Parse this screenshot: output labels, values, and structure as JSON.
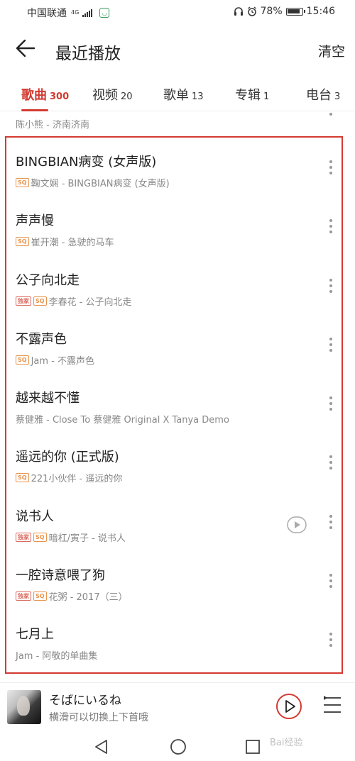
{
  "status_bar": {
    "carrier": "中国联通",
    "network_type": "4G",
    "battery_percent": "78%",
    "battery_level": 0.78,
    "time": "15:46"
  },
  "header": {
    "title": "最近播放",
    "clear_label": "清空"
  },
  "tabs": [
    {
      "label": "歌曲",
      "count": "300"
    },
    {
      "label": "视频",
      "count": "20"
    },
    {
      "label": "歌单",
      "count": "13"
    },
    {
      "label": "专辑",
      "count": "1"
    },
    {
      "label": "电台",
      "count": "3"
    }
  ],
  "partial_row": {
    "subtitle": "陈小熊 - 济南济南"
  },
  "songs": [
    {
      "title": "BINGBIAN病变 (女声版)",
      "subtitle": "鞠文娴 - BINGBIAN病变 (女声版)",
      "exclusive": false,
      "sq": true,
      "has_mv": false
    },
    {
      "title": "声声慢",
      "subtitle": "崔开潮 - 急驶的马车",
      "exclusive": false,
      "sq": true,
      "has_mv": false
    },
    {
      "title": "公子向北走",
      "subtitle": "李春花 - 公子向北走",
      "exclusive": true,
      "sq": true,
      "has_mv": false
    },
    {
      "title": "不露声色",
      "subtitle": "Jam - 不露声色",
      "exclusive": false,
      "sq": true,
      "has_mv": false
    },
    {
      "title": "越来越不懂",
      "subtitle": "蔡健雅 - Close To 蔡健雅 Original X Tanya Demo",
      "exclusive": false,
      "sq": false,
      "has_mv": false
    },
    {
      "title": "遥远的你 (正式版)",
      "subtitle": "221小伙伴 - 遥远的你",
      "exclusive": false,
      "sq": true,
      "has_mv": false
    },
    {
      "title": "说书人",
      "subtitle": "暗杠/寅子 - 说书人",
      "exclusive": true,
      "sq": true,
      "has_mv": true
    },
    {
      "title": "一腔诗意喂了狗",
      "subtitle": "花粥 - 2017（三）",
      "exclusive": true,
      "sq": true,
      "has_mv": false
    },
    {
      "title": "七月上",
      "subtitle": "Jam - 阿敬的单曲集",
      "exclusive": false,
      "sq": false,
      "has_mv": false
    }
  ],
  "badges": {
    "exclusive": "独家",
    "sq": "SQ"
  },
  "player": {
    "title": "そばにいるね",
    "subtitle": "横滑可以切换上下首哦"
  },
  "watermark": "Bai经验",
  "colors": {
    "accent": "#d33a31",
    "sq_badge": "#e8934c",
    "exclusive_badge": "#d96a5e"
  },
  "icons": {
    "back": "arrow-left-icon",
    "more": "more-vertical-icon",
    "mv": "play-circle-icon",
    "play": "play-icon",
    "playlist": "playlist-icon"
  }
}
